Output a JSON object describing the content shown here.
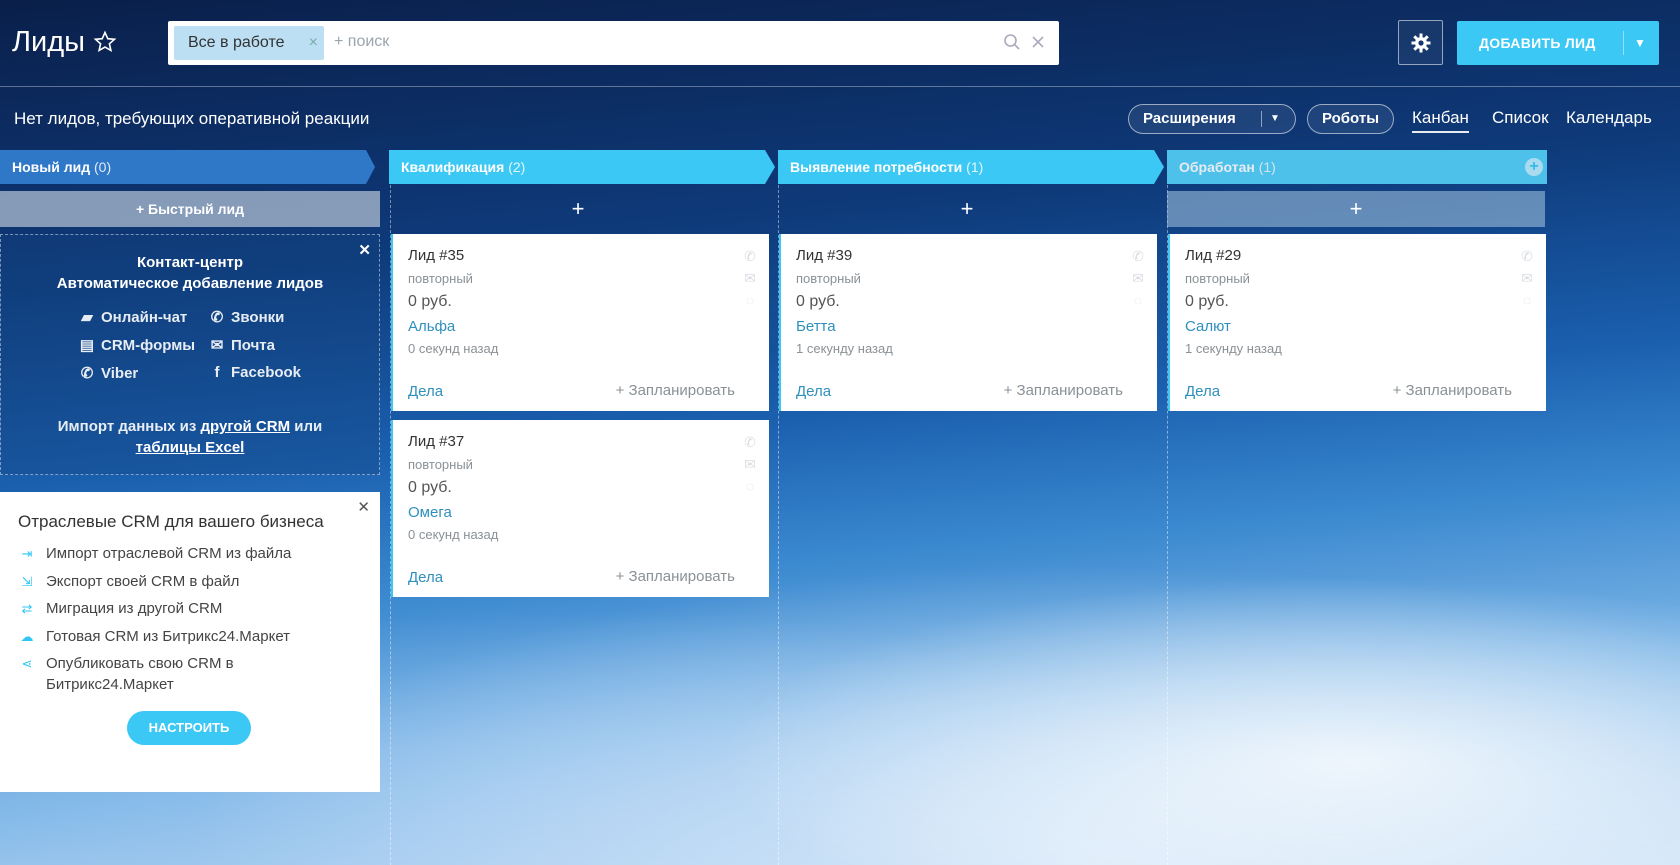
{
  "header": {
    "title": "Лиды",
    "filter_chip": "Все в работе",
    "search_placeholder": "+ поиск",
    "add_button": "ДОБАВИТЬ ЛИД"
  },
  "toolbar": {
    "status": "Нет лидов, требующих оперативной реакции",
    "extensions": "Расширения",
    "robots": "Роботы",
    "views": [
      "Канбан",
      "Список",
      "Календарь"
    ]
  },
  "columns": [
    {
      "name": "Новый лид",
      "count": "(0)"
    },
    {
      "name": "Квалификация",
      "count": "(2)"
    },
    {
      "name": "Выявление потребности",
      "count": "(1)"
    },
    {
      "name": "Обработан",
      "count": "(1)"
    }
  ],
  "quick_lead": "+ Быстрый лид",
  "add_symbol": "+",
  "contact_center": {
    "title1": "Контакт-центр",
    "title2": "Автоматическое добавление лидов",
    "channels": [
      "Онлайн-чат",
      "Звонки",
      "CRM-формы",
      "Почта",
      "Viber",
      "Facebook"
    ],
    "import_prefix": "Импорт данных из",
    "import_link1": "другой CRM",
    "import_or": "или",
    "import_link2": "таблицы Excel"
  },
  "crm_promo": {
    "title": "Отраслевые CRM для вашего бизнеса",
    "items": [
      "Импорт отраслевой CRM из файла",
      "Экспорт своей CRM в файл",
      "Миграция из другой CRM",
      "Готовая CRM из Битрикс24.Маркет",
      "Опубликовать свою CRM в",
      "Битрикс24.Маркет"
    ],
    "button": "НАСТРОИТЬ"
  },
  "cards": [
    {
      "title": "Лид #35",
      "status": "повторный",
      "price": "0 руб.",
      "client": "Альфа",
      "time": "0 секунд назад",
      "deals": "Дела",
      "plan": "+ Запланировать"
    },
    {
      "title": "Лид #37",
      "status": "повторный",
      "price": "0 руб.",
      "client": "Омега",
      "time": "0 секунд назад",
      "deals": "Дела",
      "plan": "+ Запланировать"
    },
    {
      "title": "Лид #39",
      "status": "повторный",
      "price": "0 руб.",
      "client": "Бетта",
      "time": "1 секунду назад",
      "deals": "Дела",
      "plan": "+ Запланировать"
    },
    {
      "title": "Лид #29",
      "status": "повторный",
      "price": "0 руб.",
      "client": "Салют",
      "time": "1 секунду назад",
      "deals": "Дела",
      "plan": "+ Запланировать"
    }
  ],
  "colors": {
    "accent": "#3bc8f5",
    "new_column": "#2f78c8",
    "link": "#2f8fbd"
  }
}
